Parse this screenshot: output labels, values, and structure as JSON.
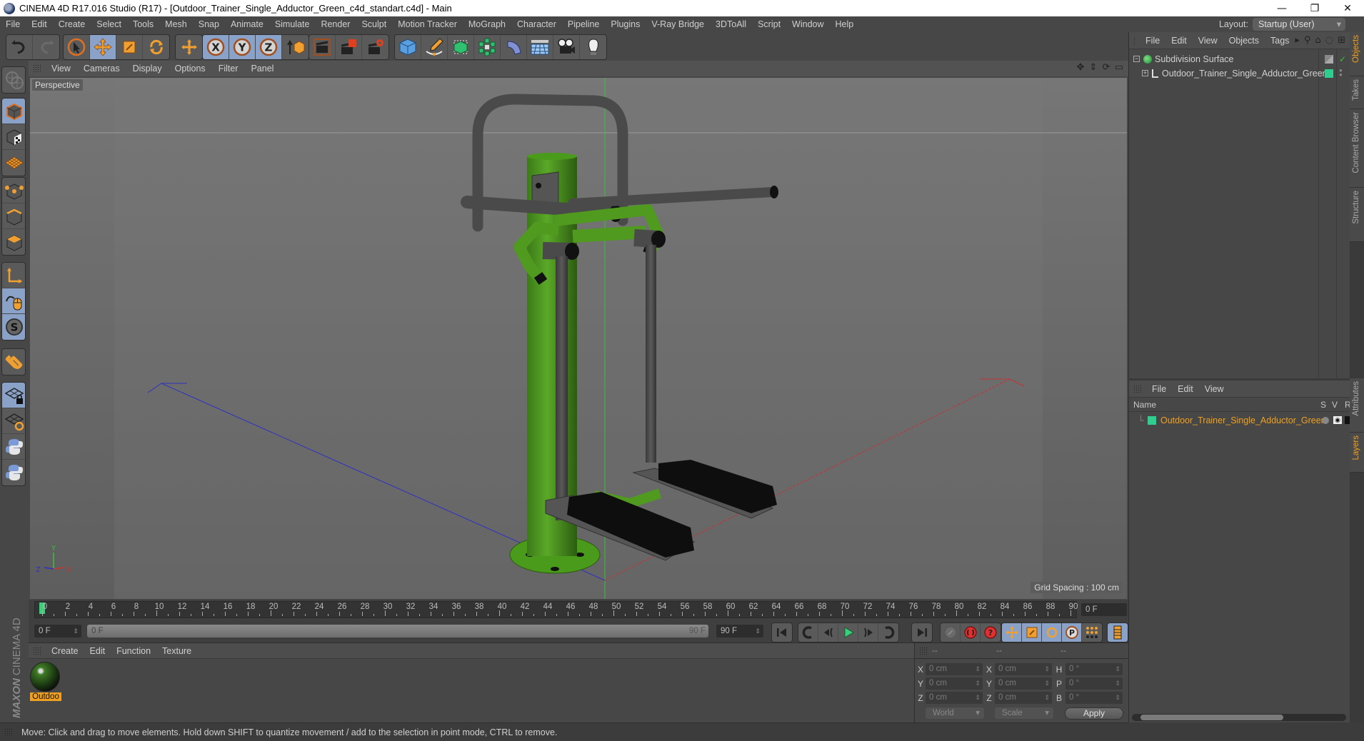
{
  "window": {
    "title": "CINEMA 4D R17.016 Studio (R17) - [Outdoor_Trainer_Single_Adductor_Green_c4d_standart.c4d] - Main",
    "minimize_icon": "—",
    "restore_icon": "❐",
    "close_icon": "✕"
  },
  "menubar": {
    "items": [
      "File",
      "Edit",
      "Create",
      "Select",
      "Tools",
      "Mesh",
      "Snap",
      "Animate",
      "Simulate",
      "Render",
      "Sculpt",
      "Motion Tracker",
      "MoGraph",
      "Character",
      "Pipeline",
      "Plugins",
      "V-Ray Bridge",
      "3DToAll",
      "Script",
      "Window",
      "Help"
    ],
    "layout_label": "Layout:",
    "layout_value": "Startup (User)"
  },
  "toolbar": {
    "groups": [
      [
        "undo",
        "redo"
      ],
      [
        "live-selection",
        "move",
        "scale",
        "rotate"
      ],
      [
        "last-tool"
      ],
      [
        "x-axis",
        "y-axis",
        "z-axis",
        "coordinate-system"
      ],
      [
        "render-view",
        "render-to-picture-viewer",
        "render-settings"
      ],
      [
        "cube",
        "pen-spline",
        "subdivision-surface",
        "cloner",
        "deformer",
        "floor",
        "camera",
        "light"
      ]
    ],
    "axis_labels": [
      "X",
      "Y",
      "Z"
    ]
  },
  "left_toolbar": {
    "tools": [
      "make-editable",
      "model-mode",
      "texture-mode",
      "workplane-mode",
      "points-mode",
      "edges-mode",
      "polygons-mode",
      "axis-mode",
      "tweak-mode",
      "solo-mode",
      "snapping",
      "locked-workplane",
      "workplane-align",
      "python-1",
      "python-2"
    ],
    "solo_label": "S"
  },
  "viewport": {
    "menu": [
      "View",
      "Cameras",
      "Display",
      "Options",
      "Filter",
      "Panel"
    ],
    "camera_label": "Perspective",
    "grid_spacing": "Grid Spacing : 100 cm",
    "axis_labels": {
      "x": "X",
      "y": "Y",
      "z": "Z"
    },
    "colors": {
      "model_green": "#4f9a1f",
      "metal_gray": "#4a4a4a",
      "pedal_black": "#111111",
      "x_axis": "#c83232",
      "y_axis": "#32c832",
      "z_axis": "#3232c8"
    }
  },
  "timeline": {
    "ticks": [
      0,
      2,
      4,
      6,
      8,
      10,
      12,
      14,
      16,
      18,
      20,
      22,
      24,
      26,
      28,
      30,
      32,
      34,
      36,
      38,
      40,
      42,
      44,
      46,
      48,
      50,
      52,
      54,
      56,
      58,
      60,
      62,
      64,
      66,
      68,
      70,
      72,
      74,
      76,
      78,
      80,
      82,
      84,
      86,
      88,
      90
    ],
    "current_frame": "0 F",
    "playhead_frame": 0,
    "max_frame": 90
  },
  "transport": {
    "start_field": "0 F",
    "range_start": "0 F",
    "range_end": "90 F",
    "end_field": "90 F",
    "buttons": [
      "go-to-start",
      "previous-key",
      "previous-frame",
      "play-forward",
      "next-frame",
      "next-key",
      "go-to-end"
    ],
    "record_buttons": [
      "motion-clip",
      "record-active-objects",
      "autokeying"
    ],
    "key_buttons": [
      "position-key",
      "scale-key",
      "rotation-key",
      "parameter-key",
      "point-level-animation"
    ],
    "timeline_button": "timeline"
  },
  "material_manager": {
    "menu": [
      "Create",
      "Edit",
      "Function",
      "Texture"
    ],
    "materials": [
      {
        "label": "Outdoo"
      }
    ]
  },
  "branding": {
    "maxon": "MAXON",
    "product": "CINEMA 4D"
  },
  "coordinates": {
    "headers": [
      "--",
      "--",
      "--"
    ],
    "rows": [
      {
        "pos_label": "X",
        "pos": "0 cm",
        "size_label": "X",
        "size": "0 cm",
        "rot_label": "H",
        "rot": "0 °"
      },
      {
        "pos_label": "Y",
        "pos": "0 cm",
        "size_label": "Y",
        "size": "0 cm",
        "rot_label": "P",
        "rot": "0 °"
      },
      {
        "pos_label": "Z",
        "pos": "0 cm",
        "size_label": "Z",
        "size": "0 cm",
        "rot_label": "B",
        "rot": "0 °"
      }
    ],
    "space_dropdown": "World",
    "mode_dropdown": "Scale",
    "apply_label": "Apply"
  },
  "status_bar": {
    "message": "Move: Click and drag to move elements. Hold down SHIFT to quantize movement / add to the selection in point mode, CTRL to remove."
  },
  "object_manager": {
    "menu": [
      "File",
      "Edit",
      "View",
      "Objects",
      "Tags"
    ],
    "objects": [
      {
        "name": "Subdivision Surface",
        "expander": "−",
        "type": "subdivision-surface"
      },
      {
        "name": "Outdoor_Trainer_Single_Adductor_Green",
        "expander": "+",
        "type": "null",
        "color": "#2ecf8e"
      }
    ]
  },
  "layers_manager": {
    "menu": [
      "File",
      "Edit",
      "View"
    ],
    "columns": [
      "Name",
      "S",
      "V",
      "R"
    ],
    "layers": [
      {
        "name": "Outdoor_Trainer_Single_Adductor_Green",
        "color": "#2ecf8e"
      }
    ]
  },
  "right_tabs": [
    {
      "label": "Objects",
      "active": true
    },
    {
      "label": "Takes",
      "active": false
    },
    {
      "label": "Content Browser",
      "active": false
    },
    {
      "label": "Structure",
      "active": false
    },
    {
      "label": "Attributes",
      "active": false
    },
    {
      "label": "Layers",
      "active": true
    }
  ]
}
